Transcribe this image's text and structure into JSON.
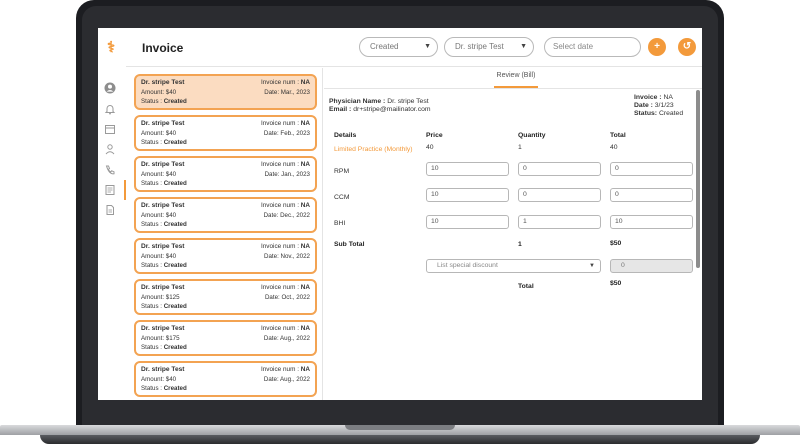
{
  "app": {
    "logo_glyph": "⚕",
    "title": "Invoice"
  },
  "rail": {
    "icons": [
      "user-circle-icon",
      "bell-icon",
      "calendar-icon",
      "person-icon",
      "phone-icon",
      "invoice-icon",
      "document-icon"
    ]
  },
  "header": {
    "status_filter": "Created",
    "physician_filter": "Dr. stripe Test",
    "date_placeholder": "Select date",
    "add_label": "+",
    "refresh_label": "↺"
  },
  "invoices": [
    {
      "name": "Dr. stripe Test",
      "invoice_label": "Invoice num :",
      "invoice_num": "NA",
      "amount": "Amount: $40",
      "date": "Date: Mar., 2023",
      "status_label": "Status :",
      "status": "Created",
      "selected": true
    },
    {
      "name": "Dr. stripe Test",
      "invoice_label": "Invoice num :",
      "invoice_num": "NA",
      "amount": "Amount: $40",
      "date": "Date: Feb., 2023",
      "status_label": "Status :",
      "status": "Created"
    },
    {
      "name": "Dr. stripe Test",
      "invoice_label": "Invoice num :",
      "invoice_num": "NA",
      "amount": "Amount: $40",
      "date": "Date: Jan., 2023",
      "status_label": "Status :",
      "status": "Created"
    },
    {
      "name": "Dr. stripe Test",
      "invoice_label": "Invoice num :",
      "invoice_num": "NA",
      "amount": "Amount: $40",
      "date": "Date: Dec., 2022",
      "status_label": "Status :",
      "status": "Created"
    },
    {
      "name": "Dr. stripe Test",
      "invoice_label": "Invoice num :",
      "invoice_num": "NA",
      "amount": "Amount: $40",
      "date": "Date: Nov., 2022",
      "status_label": "Status :",
      "status": "Created"
    },
    {
      "name": "Dr. stripe Test",
      "invoice_label": "Invoice num :",
      "invoice_num": "NA",
      "amount": "Amount: $125",
      "date": "Date: Oct., 2022",
      "status_label": "Status :",
      "status": "Created"
    },
    {
      "name": "Dr. stripe Test",
      "invoice_label": "Invoice num :",
      "invoice_num": "NA",
      "amount": "Amount: $175",
      "date": "Date: Aug., 2022",
      "status_label": "Status :",
      "status": "Created"
    },
    {
      "name": "Dr. stripe Test",
      "invoice_label": "Invoice num :",
      "invoice_num": "NA",
      "amount": "Amount: $40",
      "date": "Date: Aug., 2022",
      "status_label": "Status :",
      "status": "Created"
    }
  ],
  "detail": {
    "tab": "Review (Bill)",
    "physician_label": "Physician Name :",
    "physician_name": "Dr. stripe Test",
    "email_label": "Email :",
    "email": "dr+stripe@mailinator.com",
    "invoice_label": "Invoice :",
    "invoice_value": "NA",
    "date_label": "Date :",
    "date_value": "3/1/23",
    "status_label": "Status:",
    "status_value": "Created",
    "columns": {
      "details": "Details",
      "price": "Price",
      "quantity": "Quantity",
      "total": "Total"
    },
    "plan": {
      "name": "Limited Practice (Monthly)",
      "price": "40",
      "quantity": "1",
      "total": "40"
    },
    "lines": [
      {
        "label": "RPM",
        "price": "10",
        "quantity": "0",
        "total": "0"
      },
      {
        "label": "CCM",
        "price": "10",
        "quantity": "0",
        "total": "0"
      },
      {
        "label": "BHI",
        "price": "10",
        "quantity": "1",
        "total": "10"
      }
    ],
    "subtotal_label": "Sub Total",
    "subtotal_qty": "1",
    "subtotal_amount": "$50",
    "discount_placeholder": "List special discount",
    "discount_value": "0",
    "total_label": "Total",
    "total_amount": "$50"
  }
}
